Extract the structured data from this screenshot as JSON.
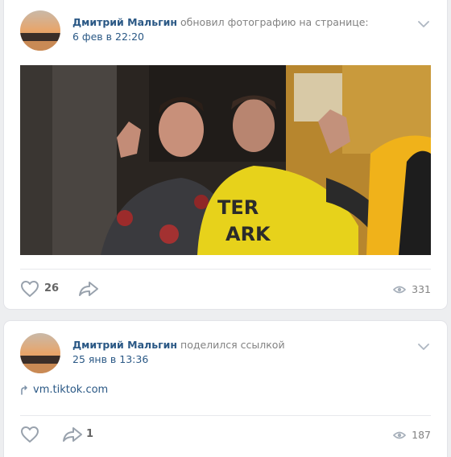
{
  "posts": [
    {
      "author": "Дмитрий Мальгин",
      "action": "обновил фотографию на странице:",
      "date": "6 фев в 22:20",
      "likes": "26",
      "shares": "",
      "views": "331"
    },
    {
      "author": "Дмитрий Мальгин",
      "action": "поделился ссылкой",
      "date": "25 янв в 13:36",
      "link_text": "vm.tiktok.com",
      "likes": "",
      "shares": "1",
      "views": "187"
    }
  ],
  "icons": {
    "like": "heart-icon",
    "share": "share-arrow-icon",
    "views": "eye-icon",
    "menu": "chevron-down-icon",
    "link": "link-arrow-icon"
  },
  "colors": {
    "link": "#2a5885",
    "muted": "#828282",
    "background": "#edeef0",
    "card": "#ffffff"
  }
}
